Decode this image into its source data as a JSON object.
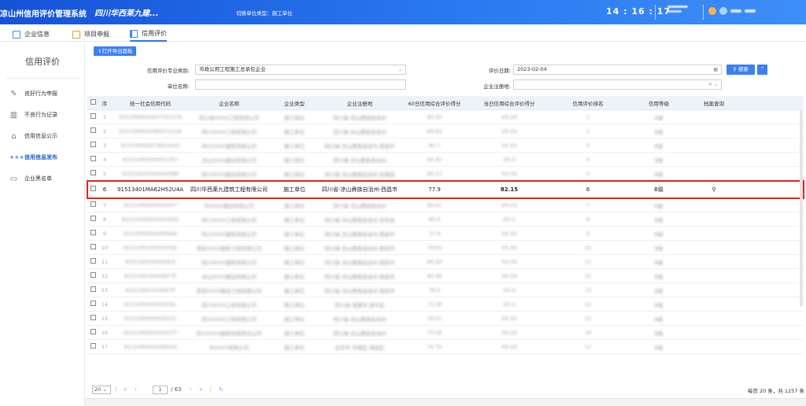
{
  "header": {
    "system_title": "凉山州信用评价管理系统",
    "org_name": "四川华西莱九建...",
    "unit_type_label": "切换单位类型：施工单位",
    "clock": "14 : 16 : 17"
  },
  "tabs": [
    {
      "label": "企业信息"
    },
    {
      "label": "项目申报"
    },
    {
      "label": "信用评价"
    }
  ],
  "sidebar": {
    "title": "信用评价",
    "items": [
      {
        "label": "良好行为申报"
      },
      {
        "label": "不良行为记录"
      },
      {
        "label": "信用信息公示"
      },
      {
        "label": "信用信息发布"
      },
      {
        "label": "企业黑名单"
      }
    ]
  },
  "filters": {
    "export_label": "打开导出面板",
    "category_label": "信用评价专业类别:",
    "category_value": "市政公用工程施工总承包企业",
    "date_label": "评价日期:",
    "date_value": "2023-02-04",
    "unit_name_label": "单位名称:",
    "unit_name_value": "",
    "reg_place_label": "企业注册地:",
    "reg_place_value": "",
    "search_label": "搜索"
  },
  "table": {
    "columns": [
      "序",
      "统一社会信用代码",
      "企业名称",
      "企业类型",
      "企业注册地",
      "60日信用综合评价得分",
      "当日信用综合评价得分",
      "信用评价排名",
      "信用等级",
      "档案查询"
    ],
    "rows": [
      {
        "no": "1",
        "code": "91510000XXXX7721279",
        "name": "四川省XXXX工程有限公司",
        "type": "施工单位",
        "place": "四川省-凉山彝族自治州",
        "score60": "85.34",
        "score": "XX.XX",
        "rank": "1",
        "level": "A级",
        "highlight": false
      },
      {
        "no": "2",
        "code": "91513400XX58037114A",
        "name": "四川XXXX工程有限公司",
        "type": "施工单位",
        "place": "四川省-凉山彝族自治州",
        "score60": "84.64",
        "score": "XX.XX",
        "rank": "2",
        "level": "B级",
        "highlight": false
      },
      {
        "no": "3",
        "code": "91510000XX74614143",
        "name": "四川XXXX建筑有限公司",
        "type": "施工单位",
        "place": "四川省-凉山彝族自治州-西昌市",
        "score60": "80.7",
        "score": "XX.XX",
        "rank": "3",
        "level": "B级",
        "highlight": false
      },
      {
        "no": "4",
        "code": "91513402XX0011307",
        "name": "凉山XXXX建设有限公司",
        "type": "施工单位",
        "place": "四川省-凉山彝族自治州",
        "score60": "83.42",
        "score": "XX.X",
        "rank": "4",
        "level": "B级",
        "highlight": false
      },
      {
        "no": "5",
        "code": "91513425XXXX04586",
        "name": "四川XXXX建设有限公司",
        "type": "施工单位",
        "place": "四川省-凉山彝族自治州-会理县",
        "score60": "80.13",
        "score": "XX.XX",
        "rank": "5",
        "level": "B级",
        "highlight": false
      },
      {
        "no": "6",
        "code": "91513401MA62H52U4A",
        "name": "四川华西莱九建筑工程有限公司",
        "type": "施工单位",
        "place": "四川省-凉山彝族自治州-西昌市",
        "score60": "77.9",
        "score": "82.15",
        "rank": "6",
        "level": "B级",
        "highlight": true
      },
      {
        "no": "7",
        "code": "91510000XXXX1047",
        "name": "中XXXX建设有限公司",
        "type": "施工单位",
        "place": "四川省-凉山彝族自治州",
        "score60": "80.61",
        "score": "XX.XX",
        "rank": "7",
        "level": "B级",
        "highlight": false
      },
      {
        "no": "8",
        "code": "91513400XXXX0160D",
        "name": "四川XXXX工程有限公司",
        "type": "施工单位",
        "place": "四川省-凉山彝族自治州-会东县",
        "score60": "80.0",
        "score": "XX.X",
        "rank": "8",
        "level": "B级",
        "highlight": false
      },
      {
        "no": "9",
        "code": "91510000XXXX064D",
        "name": "四川XXXX建筑有限公司",
        "type": "施工单位",
        "place": "四川省-凉山彝族自治州-西昌市",
        "score60": "77.9",
        "score": "XX.XX",
        "rank": "9",
        "level": "B级",
        "highlight": false
      },
      {
        "no": "10",
        "code": "91513401XXXX076A",
        "name": "西昌XXXX建筑工程有限公司",
        "type": "施工单位",
        "place": "四川省-凉山彝族自治州-西昌市",
        "score60": "79.64",
        "score": "XX.XX",
        "rank": "10",
        "level": "B级",
        "highlight": false
      },
      {
        "no": "11",
        "code": "91513401XXXX0C0",
        "name": "四川XXXX建筑有限公司",
        "type": "施工单位",
        "place": "四川省-凉山彝族自治州-西昌市",
        "score60": "80.29",
        "score": "XX.XX",
        "rank": "11",
        "level": "B级",
        "highlight": false
      },
      {
        "no": "12",
        "code": "91513401XXXX877F",
        "name": "凉山XXXX建设有限公司",
        "type": "施工单位",
        "place": "四川省-凉山彝族自治州-西昌市",
        "score60": "80.09",
        "score": "XX.XX",
        "rank": "12",
        "level": "B级",
        "highlight": false
      },
      {
        "no": "13",
        "code": "91513401XXXX67P",
        "name": "西昌XXXX建设工程有限公司",
        "type": "施工单位",
        "place": "四川省-凉山彝族自治州-西昌市",
        "score60": "78.0",
        "score": "XX.X",
        "rank": "13",
        "level": "B级",
        "highlight": false
      },
      {
        "no": "14",
        "code": "91510000XXXX026L",
        "name": "四川XXXX工程有限公司",
        "type": "施工单位",
        "place": "四川省-成都市-金牛区",
        "score60": "75.28",
        "score": "XX.X",
        "rank": "14",
        "level": "B级",
        "highlight": false
      },
      {
        "no": "15",
        "code": "91513400XXXX622L",
        "name": "四川XXXX工程有限公司",
        "type": "施工单位",
        "place": "四川省-凉山彝族自治州",
        "score60": "78.01",
        "score": "XX.XX",
        "rank": "15",
        "level": "B级",
        "highlight": false
      },
      {
        "no": "16",
        "code": "91513400XXXX257T",
        "name": "四川XXXX建筑有限责任公司",
        "type": "施工单位",
        "place": "四川省-凉山彝族自治州",
        "score60": "77.09",
        "score": "XX.XX",
        "rank": "16",
        "level": "B级",
        "highlight": false
      },
      {
        "no": "17",
        "code": "91110000XXXX6424",
        "name": "中XXXX有限公司",
        "type": "施工单位",
        "place": "北京市-市辖区-海淀区",
        "score60": "75.74",
        "score": "XX.XX",
        "rank": "17",
        "level": "B级",
        "highlight": false
      }
    ]
  },
  "pager": {
    "page_size": "20",
    "current_page": "1",
    "total_pages_text": "/ 63",
    "total_text": "每页 20 条，共 1257 条"
  }
}
